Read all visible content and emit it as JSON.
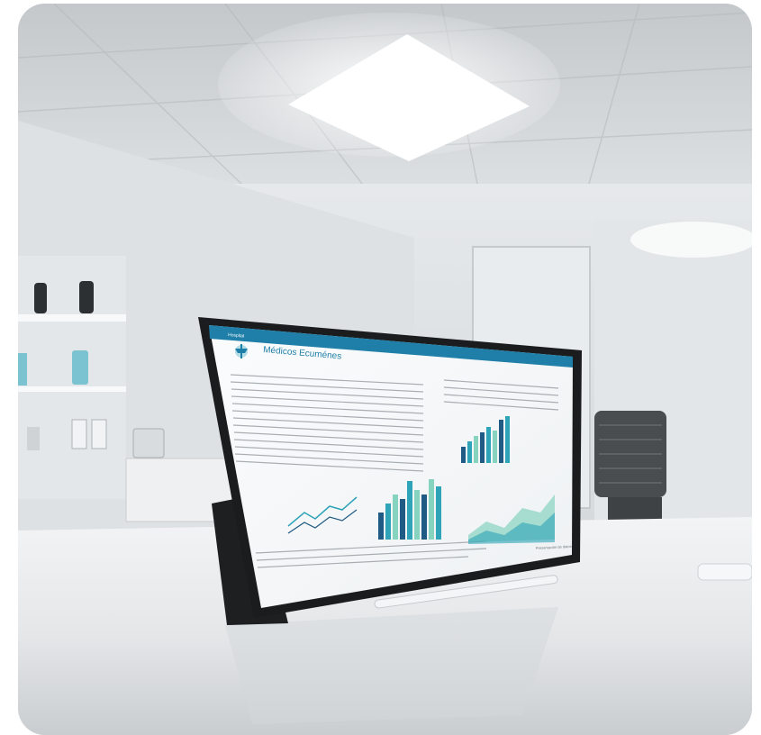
{
  "scene": {
    "description_type": "photo",
    "device": "tablet",
    "accent_color": "#1f7fa8"
  },
  "tablet_screen": {
    "header_logo_text": "Hospital",
    "brand_title": "Médicos Ecuménes",
    "chart_colors": [
      "#1f5b84",
      "#2fa3b8",
      "#86d3c0"
    ],
    "bottom_caption": "Presentación de datos"
  }
}
